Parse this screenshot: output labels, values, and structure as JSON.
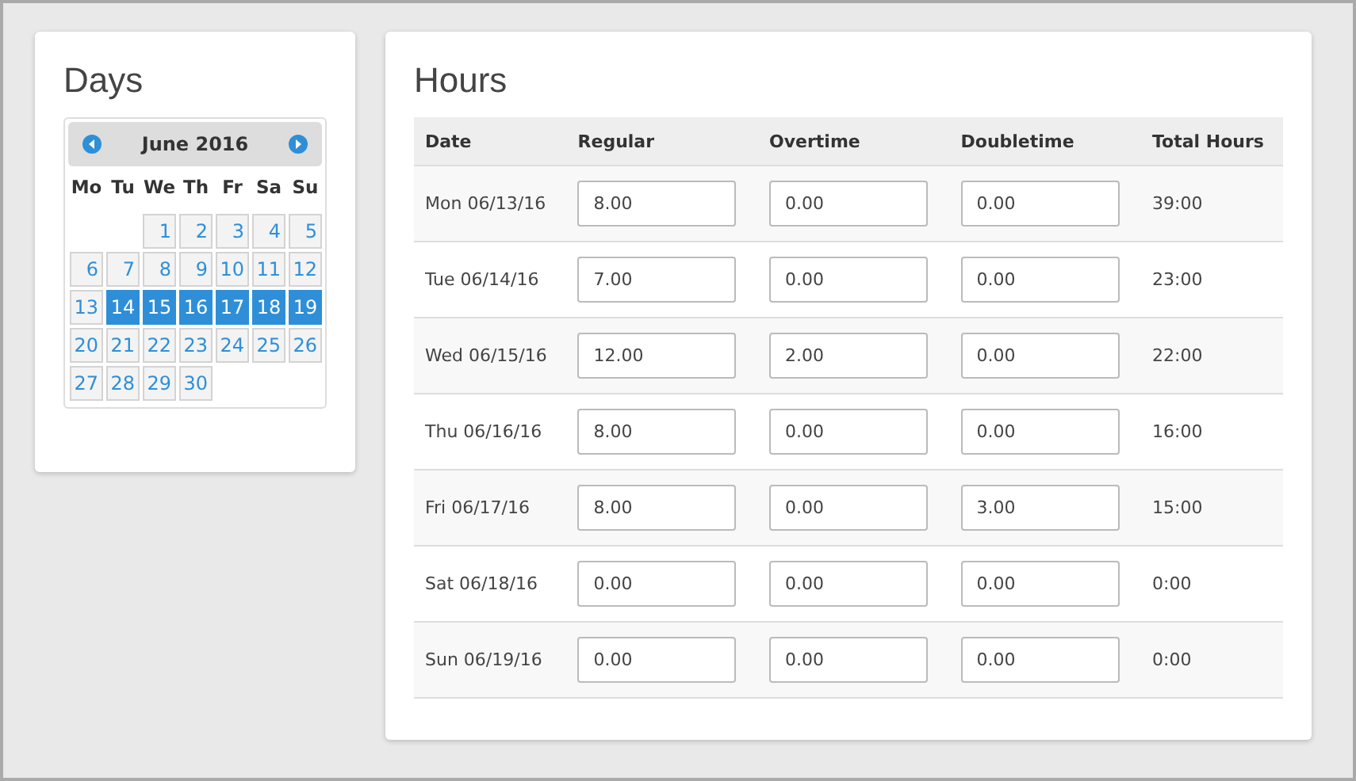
{
  "days_panel": {
    "title": "Days",
    "calendar": {
      "month": "June 2016",
      "weekdays": [
        "Mo",
        "Tu",
        "We",
        "Th",
        "Fr",
        "Sa",
        "Su"
      ],
      "weeks": [
        [
          {
            "n": "1",
            "selected": false
          },
          {
            "n": "2",
            "selected": false
          },
          {
            "n": "3",
            "selected": false
          },
          {
            "n": "4",
            "selected": false
          },
          {
            "n": "5",
            "selected": false
          }
        ],
        [
          {
            "n": "6",
            "selected": false
          },
          {
            "n": "7",
            "selected": false
          },
          {
            "n": "8",
            "selected": false
          },
          {
            "n": "9",
            "selected": false
          },
          {
            "n": "10",
            "selected": false
          },
          {
            "n": "11",
            "selected": false
          },
          {
            "n": "12",
            "selected": false
          }
        ],
        [
          {
            "n": "13",
            "selected": false
          },
          {
            "n": "14",
            "selected": true
          },
          {
            "n": "15",
            "selected": true
          },
          {
            "n": "16",
            "selected": true
          },
          {
            "n": "17",
            "selected": true
          },
          {
            "n": "18",
            "selected": true
          },
          {
            "n": "19",
            "selected": true
          }
        ],
        [
          {
            "n": "20",
            "selected": false
          },
          {
            "n": "21",
            "selected": false
          },
          {
            "n": "22",
            "selected": false
          },
          {
            "n": "23",
            "selected": false
          },
          {
            "n": "24",
            "selected": false
          },
          {
            "n": "25",
            "selected": false
          },
          {
            "n": "26",
            "selected": false
          }
        ],
        [
          {
            "n": "27",
            "selected": false
          },
          {
            "n": "28",
            "selected": false
          },
          {
            "n": "29",
            "selected": false
          },
          {
            "n": "30",
            "selected": false
          }
        ]
      ]
    }
  },
  "hours_panel": {
    "title": "Hours",
    "table": {
      "columns": [
        "Date",
        "Regular",
        "Overtime",
        "Doubletime",
        "Total Hours"
      ],
      "rows": [
        {
          "date": "Mon 06/13/16",
          "regular": "8.00",
          "overtime": "0.00",
          "doubletime": "0.00",
          "total": "39:00"
        },
        {
          "date": "Tue 06/14/16",
          "regular": "7.00",
          "overtime": "0.00",
          "doubletime": "0.00",
          "total": "23:00"
        },
        {
          "date": "Wed 06/15/16",
          "regular": "12.00",
          "overtime": "2.00",
          "doubletime": "0.00",
          "total": "22:00"
        },
        {
          "date": "Thu 06/16/16",
          "regular": "8.00",
          "overtime": "0.00",
          "doubletime": "0.00",
          "total": "16:00"
        },
        {
          "date": "Fri 06/17/16",
          "regular": "8.00",
          "overtime": "0.00",
          "doubletime": "3.00",
          "total": "15:00"
        },
        {
          "date": "Sat 06/18/16",
          "regular": "0.00",
          "overtime": "0.00",
          "doubletime": "0.00",
          "total": "0:00"
        },
        {
          "date": "Sun 06/19/16",
          "regular": "0.00",
          "overtime": "0.00",
          "doubletime": "0.00",
          "total": "0:00"
        }
      ]
    }
  }
}
